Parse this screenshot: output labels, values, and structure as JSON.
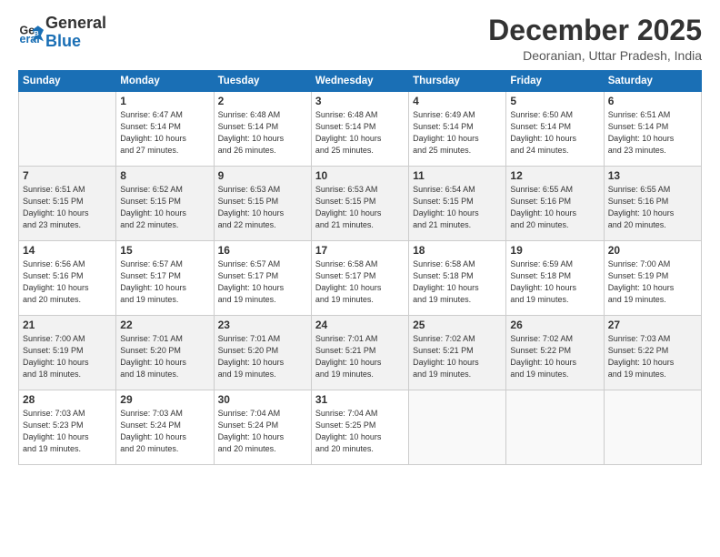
{
  "logo": {
    "text_general": "General",
    "text_blue": "Blue"
  },
  "title": "December 2025",
  "location": "Deoranian, Uttar Pradesh, India",
  "weekdays": [
    "Sunday",
    "Monday",
    "Tuesday",
    "Wednesday",
    "Thursday",
    "Friday",
    "Saturday"
  ],
  "weeks": [
    [
      {
        "day": "",
        "info": ""
      },
      {
        "day": "1",
        "info": "Sunrise: 6:47 AM\nSunset: 5:14 PM\nDaylight: 10 hours\nand 27 minutes."
      },
      {
        "day": "2",
        "info": "Sunrise: 6:48 AM\nSunset: 5:14 PM\nDaylight: 10 hours\nand 26 minutes."
      },
      {
        "day": "3",
        "info": "Sunrise: 6:48 AM\nSunset: 5:14 PM\nDaylight: 10 hours\nand 25 minutes."
      },
      {
        "day": "4",
        "info": "Sunrise: 6:49 AM\nSunset: 5:14 PM\nDaylight: 10 hours\nand 25 minutes."
      },
      {
        "day": "5",
        "info": "Sunrise: 6:50 AM\nSunset: 5:14 PM\nDaylight: 10 hours\nand 24 minutes."
      },
      {
        "day": "6",
        "info": "Sunrise: 6:51 AM\nSunset: 5:14 PM\nDaylight: 10 hours\nand 23 minutes."
      }
    ],
    [
      {
        "day": "7",
        "info": "Sunrise: 6:51 AM\nSunset: 5:15 PM\nDaylight: 10 hours\nand 23 minutes."
      },
      {
        "day": "8",
        "info": "Sunrise: 6:52 AM\nSunset: 5:15 PM\nDaylight: 10 hours\nand 22 minutes."
      },
      {
        "day": "9",
        "info": "Sunrise: 6:53 AM\nSunset: 5:15 PM\nDaylight: 10 hours\nand 22 minutes."
      },
      {
        "day": "10",
        "info": "Sunrise: 6:53 AM\nSunset: 5:15 PM\nDaylight: 10 hours\nand 21 minutes."
      },
      {
        "day": "11",
        "info": "Sunrise: 6:54 AM\nSunset: 5:15 PM\nDaylight: 10 hours\nand 21 minutes."
      },
      {
        "day": "12",
        "info": "Sunrise: 6:55 AM\nSunset: 5:16 PM\nDaylight: 10 hours\nand 20 minutes."
      },
      {
        "day": "13",
        "info": "Sunrise: 6:55 AM\nSunset: 5:16 PM\nDaylight: 10 hours\nand 20 minutes."
      }
    ],
    [
      {
        "day": "14",
        "info": "Sunrise: 6:56 AM\nSunset: 5:16 PM\nDaylight: 10 hours\nand 20 minutes."
      },
      {
        "day": "15",
        "info": "Sunrise: 6:57 AM\nSunset: 5:17 PM\nDaylight: 10 hours\nand 19 minutes."
      },
      {
        "day": "16",
        "info": "Sunrise: 6:57 AM\nSunset: 5:17 PM\nDaylight: 10 hours\nand 19 minutes."
      },
      {
        "day": "17",
        "info": "Sunrise: 6:58 AM\nSunset: 5:17 PM\nDaylight: 10 hours\nand 19 minutes."
      },
      {
        "day": "18",
        "info": "Sunrise: 6:58 AM\nSunset: 5:18 PM\nDaylight: 10 hours\nand 19 minutes."
      },
      {
        "day": "19",
        "info": "Sunrise: 6:59 AM\nSunset: 5:18 PM\nDaylight: 10 hours\nand 19 minutes."
      },
      {
        "day": "20",
        "info": "Sunrise: 7:00 AM\nSunset: 5:19 PM\nDaylight: 10 hours\nand 19 minutes."
      }
    ],
    [
      {
        "day": "21",
        "info": "Sunrise: 7:00 AM\nSunset: 5:19 PM\nDaylight: 10 hours\nand 18 minutes."
      },
      {
        "day": "22",
        "info": "Sunrise: 7:01 AM\nSunset: 5:20 PM\nDaylight: 10 hours\nand 18 minutes."
      },
      {
        "day": "23",
        "info": "Sunrise: 7:01 AM\nSunset: 5:20 PM\nDaylight: 10 hours\nand 19 minutes."
      },
      {
        "day": "24",
        "info": "Sunrise: 7:01 AM\nSunset: 5:21 PM\nDaylight: 10 hours\nand 19 minutes."
      },
      {
        "day": "25",
        "info": "Sunrise: 7:02 AM\nSunset: 5:21 PM\nDaylight: 10 hours\nand 19 minutes."
      },
      {
        "day": "26",
        "info": "Sunrise: 7:02 AM\nSunset: 5:22 PM\nDaylight: 10 hours\nand 19 minutes."
      },
      {
        "day": "27",
        "info": "Sunrise: 7:03 AM\nSunset: 5:22 PM\nDaylight: 10 hours\nand 19 minutes."
      }
    ],
    [
      {
        "day": "28",
        "info": "Sunrise: 7:03 AM\nSunset: 5:23 PM\nDaylight: 10 hours\nand 19 minutes."
      },
      {
        "day": "29",
        "info": "Sunrise: 7:03 AM\nSunset: 5:24 PM\nDaylight: 10 hours\nand 20 minutes."
      },
      {
        "day": "30",
        "info": "Sunrise: 7:04 AM\nSunset: 5:24 PM\nDaylight: 10 hours\nand 20 minutes."
      },
      {
        "day": "31",
        "info": "Sunrise: 7:04 AM\nSunset: 5:25 PM\nDaylight: 10 hours\nand 20 minutes."
      },
      {
        "day": "",
        "info": ""
      },
      {
        "day": "",
        "info": ""
      },
      {
        "day": "",
        "info": ""
      }
    ]
  ]
}
